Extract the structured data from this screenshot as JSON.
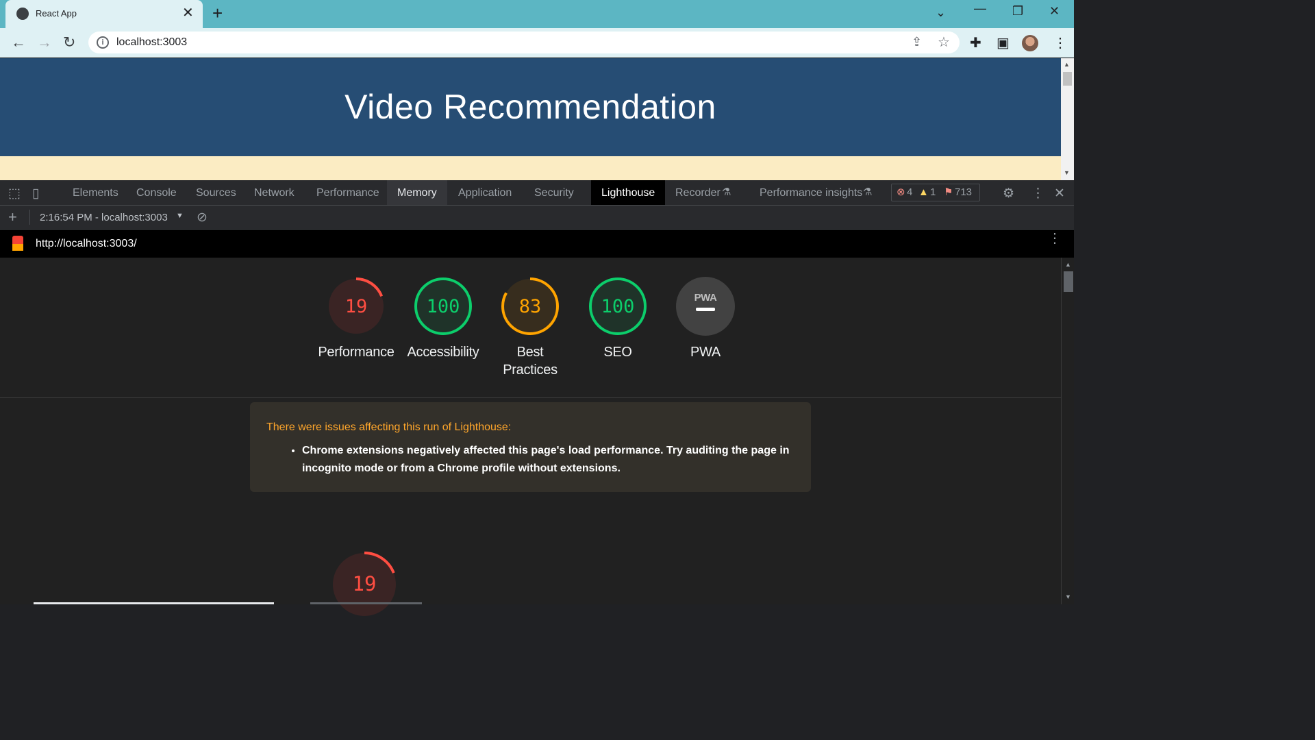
{
  "browser": {
    "tab_title": "React App",
    "url": "localhost:3003"
  },
  "page": {
    "heading": "Video Recommendation"
  },
  "devtools": {
    "tabs": [
      "Elements",
      "Console",
      "Sources",
      "Network",
      "Performance",
      "Memory",
      "Application",
      "Security",
      "Lighthouse",
      "Recorder",
      "Performance insights"
    ],
    "selected_tab": "Lighthouse",
    "errors": "4",
    "warnings": "1",
    "issues": "713",
    "report_selector": "2:16:54 PM - localhost:3003"
  },
  "lighthouse": {
    "url": "http://localhost:3003/",
    "scores": [
      {
        "label": "Performance",
        "value": "19",
        "color": "#ff4e42"
      },
      {
        "label": "Accessibility",
        "value": "100",
        "color": "#0cce6b"
      },
      {
        "label": "Best Practices",
        "value": "83",
        "color": "#ffa400"
      },
      {
        "label": "SEO",
        "value": "100",
        "color": "#0cce6b"
      },
      {
        "label": "PWA",
        "value": "",
        "color": "#9aa0a6"
      }
    ],
    "pwa_badge": "PWA",
    "warning_title": "There were issues affecting this run of Lighthouse:",
    "warning_item": "Chrome extensions negatively affected this page's load performance. Try auditing the page in incognito mode or from a Chrome profile without extensions.",
    "bottom_score": "19"
  },
  "colors": {
    "hero_bg": "#264d74",
    "page_bg": "#fbecc3",
    "tabstrip": "#5cb6c3"
  }
}
